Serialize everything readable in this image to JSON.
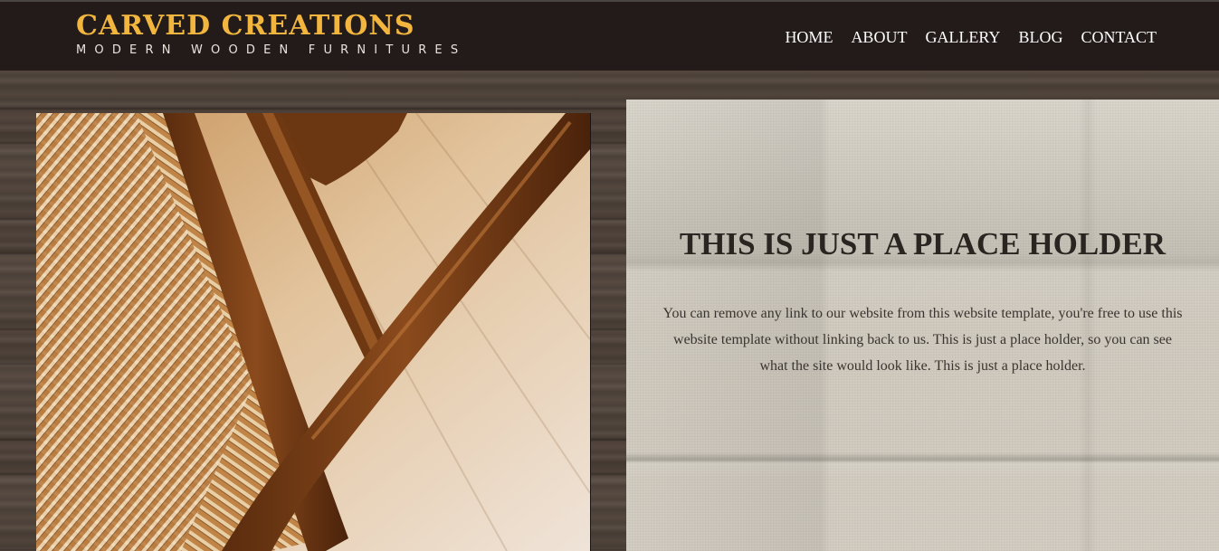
{
  "header": {
    "brand_title": "CARVED CREATIONS",
    "brand_tagline": "MODERN WOODEN FURNITURES",
    "nav": [
      "HOME",
      "ABOUT",
      "GALLERY",
      "BLOG",
      "CONTACT"
    ]
  },
  "hero": {
    "image_subject": "wooden chair with woven rush seat",
    "title": "THIS IS JUST A PLACE HOLDER",
    "body": "You can remove any link to our website from this website template, you're free to use this website template without linking back to us. This is just a place holder, so you can see what the site would look like. This is just a place holder."
  },
  "colors": {
    "header_bg": "#231b19",
    "brand_accent": "#f2b63f",
    "nav_text": "#ffffff",
    "panel_bg": "#d3cdc2",
    "panel_text": "#2a2521"
  }
}
